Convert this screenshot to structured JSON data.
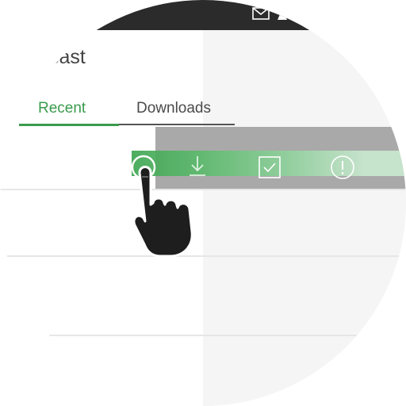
{
  "app": {
    "title_partial": "cast"
  },
  "tabs": [
    {
      "label": "Recent",
      "active": true
    },
    {
      "label": "Downloads",
      "active": false
    }
  ],
  "swipe_actions": [
    {
      "icon": "circle-icon"
    },
    {
      "icon": "download-icon"
    },
    {
      "icon": "checkbox-icon"
    },
    {
      "icon": "alert-icon"
    }
  ],
  "colors": {
    "accent": "#3b9b4d",
    "statusbar": "#2b2b2b",
    "swipe_gray": "#a9a9a9",
    "text_dark": "#4a4a4a"
  },
  "status_icons": [
    "mail-icon",
    "signal-icon"
  ]
}
